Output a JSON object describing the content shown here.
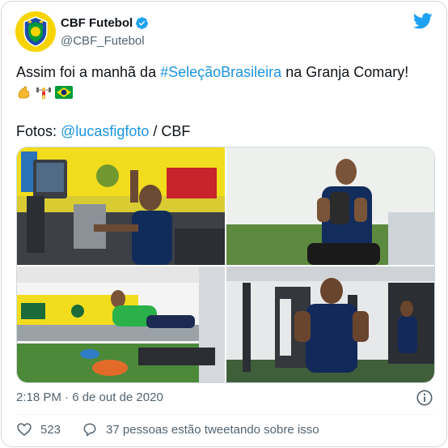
{
  "account": {
    "name": "CBF Futebol",
    "handle": "@CBF_Futebol"
  },
  "tweet": {
    "text_before": "Assim foi a manhã da ",
    "hashtag": "#SeleçãoBrasileira",
    "text_after": " na Granja Comary!",
    "emojis": [
      "flexed-biceps",
      "weight-lifter",
      "brazil-flag"
    ],
    "fotos_label": "Fotos: ",
    "mention": "@lucasfigfoto",
    "credit": " / CBF"
  },
  "media": {
    "photos": [
      {
        "subject": "player-exercising-with-cable-machine"
      },
      {
        "subject": "player-seated-holding-weight"
      },
      {
        "subject": "players-on-training-floor"
      },
      {
        "subject": "player-pulling-cable-handles"
      }
    ]
  },
  "meta": {
    "timestamp": "2:18 PM · 6 de out de 2020"
  },
  "actions": {
    "likes": "523",
    "talking": "37 pessoas estão tweetando sobre isso"
  },
  "colors": {
    "link": "#1b95e0",
    "twitter_blue": "#1da1f2",
    "muted": "#536471",
    "cbf_yellow": "#f7d400",
    "cbf_green": "#009b3a"
  }
}
